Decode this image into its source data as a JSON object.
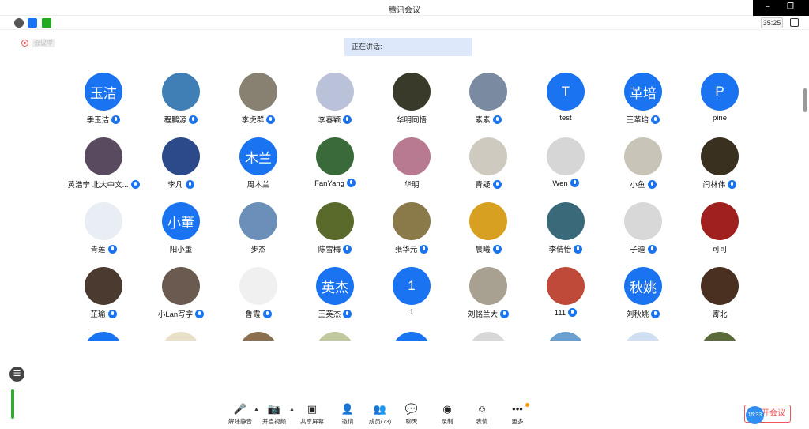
{
  "window": {
    "title": "腾讯会议",
    "minimize_icon": "–",
    "restore_icon": "❐"
  },
  "status": {
    "timer": "35:25",
    "recording_label": "会议中"
  },
  "speaking": {
    "label": "正在讲话:"
  },
  "participants": [
    {
      "name": "季玉洁",
      "avatar_text": "玉洁",
      "avatar_color": "#1a73f0",
      "mic": true
    },
    {
      "name": "程鹏源",
      "avatar_text": "",
      "avatar_color": "#3f7fb5",
      "mic": true
    },
    {
      "name": "李虎群",
      "avatar_text": "",
      "avatar_color": "#888070",
      "mic": true
    },
    {
      "name": "李春颖",
      "avatar_text": "",
      "avatar_color": "#b9c2d8",
      "mic": true
    },
    {
      "name": "华明同悟",
      "avatar_text": "",
      "avatar_color": "#3a3a2a",
      "mic": false
    },
    {
      "name": "素素",
      "avatar_text": "",
      "avatar_color": "#7a8aa0",
      "mic": true
    },
    {
      "name": "test",
      "avatar_text": "T",
      "avatar_color": "#1a73f0",
      "mic": false
    },
    {
      "name": "王革培",
      "avatar_text": "革培",
      "avatar_color": "#1a73f0",
      "mic": true
    },
    {
      "name": "pine",
      "avatar_text": "P",
      "avatar_color": "#1a73f0",
      "mic": false
    },
    {
      "name": "黄浩宁 北大中文...",
      "avatar_text": "",
      "avatar_color": "#5a4a60",
      "mic": true
    },
    {
      "name": "李凡",
      "avatar_text": "",
      "avatar_color": "#2c4a8a",
      "mic": true
    },
    {
      "name": "周木兰",
      "avatar_text": "木兰",
      "avatar_color": "#1a73f0",
      "mic": false
    },
    {
      "name": "FanYang",
      "avatar_text": "",
      "avatar_color": "#3a6a3a",
      "mic": true
    },
    {
      "name": "华明",
      "avatar_text": "",
      "avatar_color": "#b87a90",
      "mic": false
    },
    {
      "name": "青疑",
      "avatar_text": "",
      "avatar_color": "#cfcac0",
      "mic": true
    },
    {
      "name": "Wen",
      "avatar_text": "",
      "avatar_color": "#d6d6d6",
      "mic": true
    },
    {
      "name": "小鱼",
      "avatar_text": "",
      "avatar_color": "#c8c4b8",
      "mic": true
    },
    {
      "name": "闫林伟",
      "avatar_text": "",
      "avatar_color": "#3a3020",
      "mic": true
    },
    {
      "name": "青莲",
      "avatar_text": "",
      "avatar_color": "#e8eef4",
      "mic": true
    },
    {
      "name": "阳小董",
      "avatar_text": "小董",
      "avatar_color": "#1a73f0",
      "mic": false
    },
    {
      "name": "步杰",
      "avatar_text": "",
      "avatar_color": "#6b8fb8",
      "mic": false
    },
    {
      "name": "陈雪梅",
      "avatar_text": "",
      "avatar_color": "#5a6a2a",
      "mic": true
    },
    {
      "name": "张华元",
      "avatar_text": "",
      "avatar_color": "#8a7a4a",
      "mic": true
    },
    {
      "name": "晨曦",
      "avatar_text": "",
      "avatar_color": "#d8a020",
      "mic": true
    },
    {
      "name": "李倩怡",
      "avatar_text": "",
      "avatar_color": "#3a6a7a",
      "mic": true
    },
    {
      "name": "子迪",
      "avatar_text": "",
      "avatar_color": "#d8d8d8",
      "mic": true
    },
    {
      "name": "可可",
      "avatar_text": "",
      "avatar_color": "#a02020",
      "mic": false
    },
    {
      "name": "芷瑜",
      "avatar_text": "",
      "avatar_color": "#4a3a30",
      "mic": true
    },
    {
      "name": "小Lan写字",
      "avatar_text": "",
      "avatar_color": "#6a5a50",
      "mic": true
    },
    {
      "name": "鲁霞",
      "avatar_text": "",
      "avatar_color": "#f0f0f0",
      "mic": true
    },
    {
      "name": "王英杰",
      "avatar_text": "英杰",
      "avatar_color": "#1a73f0",
      "mic": true
    },
    {
      "name": "1",
      "avatar_text": "1",
      "avatar_color": "#1a73f0",
      "mic": false
    },
    {
      "name": "刘铭兰大",
      "avatar_text": "",
      "avatar_color": "#a8a090",
      "mic": true
    },
    {
      "name": "111",
      "avatar_text": "",
      "avatar_color": "#c04a3a",
      "mic": true
    },
    {
      "name": "刘秋姚",
      "avatar_text": "秋姚",
      "avatar_color": "#1a73f0",
      "mic": true
    },
    {
      "name": "寄北",
      "avatar_text": "",
      "avatar_color": "#4a3020",
      "mic": false
    },
    {
      "name": "",
      "avatar_text": "",
      "avatar_color": "#1a73f0",
      "mic": false
    },
    {
      "name": "",
      "avatar_text": "",
      "avatar_color": "#e8e0c8",
      "mic": false
    },
    {
      "name": "",
      "avatar_text": "",
      "avatar_color": "#8a7050",
      "mic": false
    },
    {
      "name": "",
      "avatar_text": "",
      "avatar_color": "#c0c8a0",
      "mic": false
    },
    {
      "name": "",
      "avatar_text": "",
      "avatar_color": "#1a73f0",
      "mic": false
    },
    {
      "name": "",
      "avatar_text": "",
      "avatar_color": "#d8d8d8",
      "mic": false
    },
    {
      "name": "",
      "avatar_text": "",
      "avatar_color": "#6aa0d0",
      "mic": false
    },
    {
      "name": "",
      "avatar_text": "",
      "avatar_color": "#d0e0f0",
      "mic": false
    },
    {
      "name": "",
      "avatar_text": "",
      "avatar_color": "#5a6a3a",
      "mic": false
    }
  ],
  "toolbar": {
    "mute": {
      "label": "解除静音",
      "icon": "mic-off-icon"
    },
    "video": {
      "label": "开启视频",
      "icon": "camera-off-icon"
    },
    "share": {
      "label": "共享屏幕",
      "icon": "share-screen-icon"
    },
    "invite": {
      "label": "邀请",
      "icon": "add-user-icon"
    },
    "members": {
      "label": "成员(73)",
      "icon": "members-icon"
    },
    "chat": {
      "label": "聊天",
      "icon": "chat-icon"
    },
    "record": {
      "label": "录制",
      "icon": "record-icon"
    },
    "reaction": {
      "label": "表情",
      "icon": "emoji-icon"
    },
    "more": {
      "label": "更多",
      "icon": "more-icon"
    }
  },
  "end": {
    "label": "开会议",
    "time": "15:33"
  },
  "colors": {
    "accent": "#1a73f0",
    "danger": "#e55555"
  }
}
